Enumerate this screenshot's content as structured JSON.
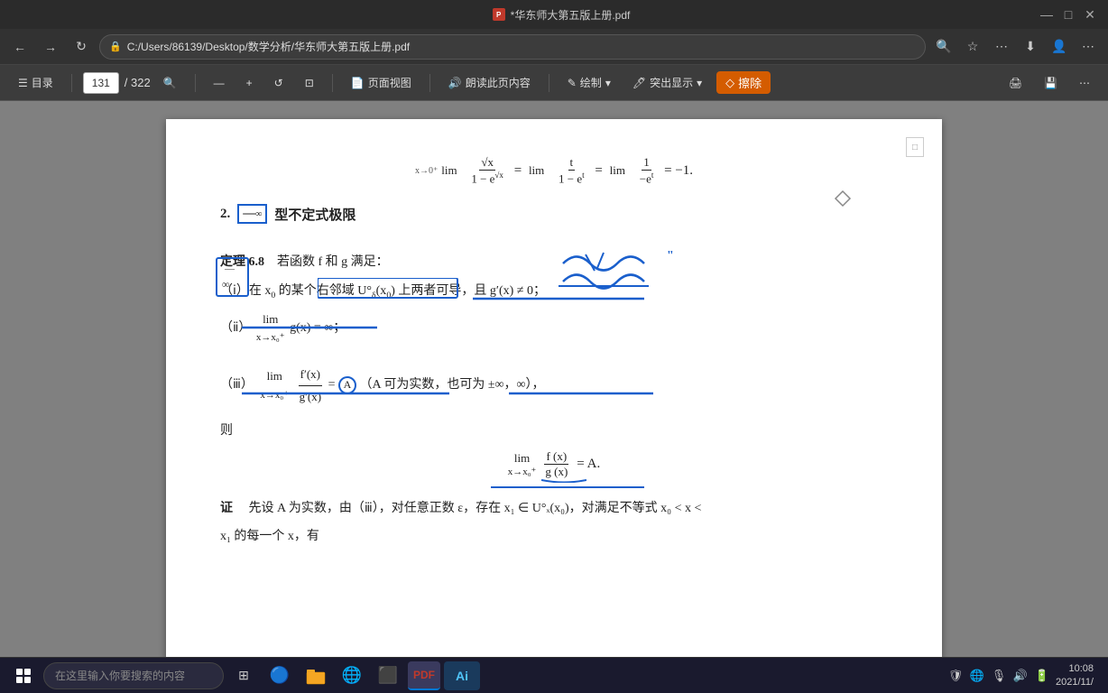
{
  "titleBar": {
    "title": "*华东师大第五版上册.pdf",
    "icon": "PDF",
    "controls": [
      "—",
      "□",
      "✕"
    ]
  },
  "browserToolbar": {
    "back": "←",
    "forward": "→",
    "refresh": "↺",
    "address": "C:/Users/86139/Desktop/数学分析/华东师大第五版上册.pdf",
    "lockIcon": "🔒"
  },
  "pdfToolbar": {
    "menu": "☰",
    "menuLabel": "目录",
    "pageNum": "131",
    "totalPages": "/ 322",
    "search": "🔍",
    "zoomOut": "—",
    "zoomAdd": "+",
    "rotateLeft": "↺",
    "pageFit": "⊡",
    "divider1": "|",
    "pageView": "📄",
    "pageViewLabel": "页面视图",
    "divider2": "|",
    "readAloud": "朗读此页内容",
    "drawLabel": "绘制",
    "highlight": "突出显示",
    "eraseLabel": "擦除"
  },
  "mathContent": {
    "line1": "lim (√x)/(1−e^(√x)) = lim t/(1−e^t) = lim 1/(−e^t) = −1.",
    "section2": "2. ∞/∞ 型不定式极限",
    "theorem": "定理 6.8",
    "theoremText": "若函数 f 和 g 满足：",
    "condition1": "（ⅰ）在 x₀ 的某个右邻域 U°ₓ(x₀) 上两者可导，且 g′(x) ≠ 0；",
    "condition2": "（ⅱ）lim g(x) = ∞；",
    "condition2limit": "x→x₀⁺",
    "condition3": "（ⅲ）lim f′(x)/g′(x) = A（A 可为实数，也可为 ±∞，∞），",
    "condition3limit": "x→x₀⁺",
    "ze": "则",
    "conclusion": "lim f(x)/g(x) = A.",
    "conclusionLimit": "x→x₀⁺",
    "proofLabel": "证",
    "proofText": "先设 A 为实数，由（ⅲ），对任意正数 ε，存在 x₁ ∈ U°ₓ(x₀)，对满足不等式 x₀ < x <",
    "proofLine2": "x₁ 的每一个 x，有"
  },
  "taskbar": {
    "searchPlaceholder": "在这里输入你要搜索的内容",
    "time": "10:08",
    "date": "2021/11/",
    "startIcon": "⊞",
    "apps": [
      "⊞",
      "⊕",
      "📁",
      "🌐",
      "🔷",
      "📊"
    ],
    "aiLabel": "Ai"
  }
}
